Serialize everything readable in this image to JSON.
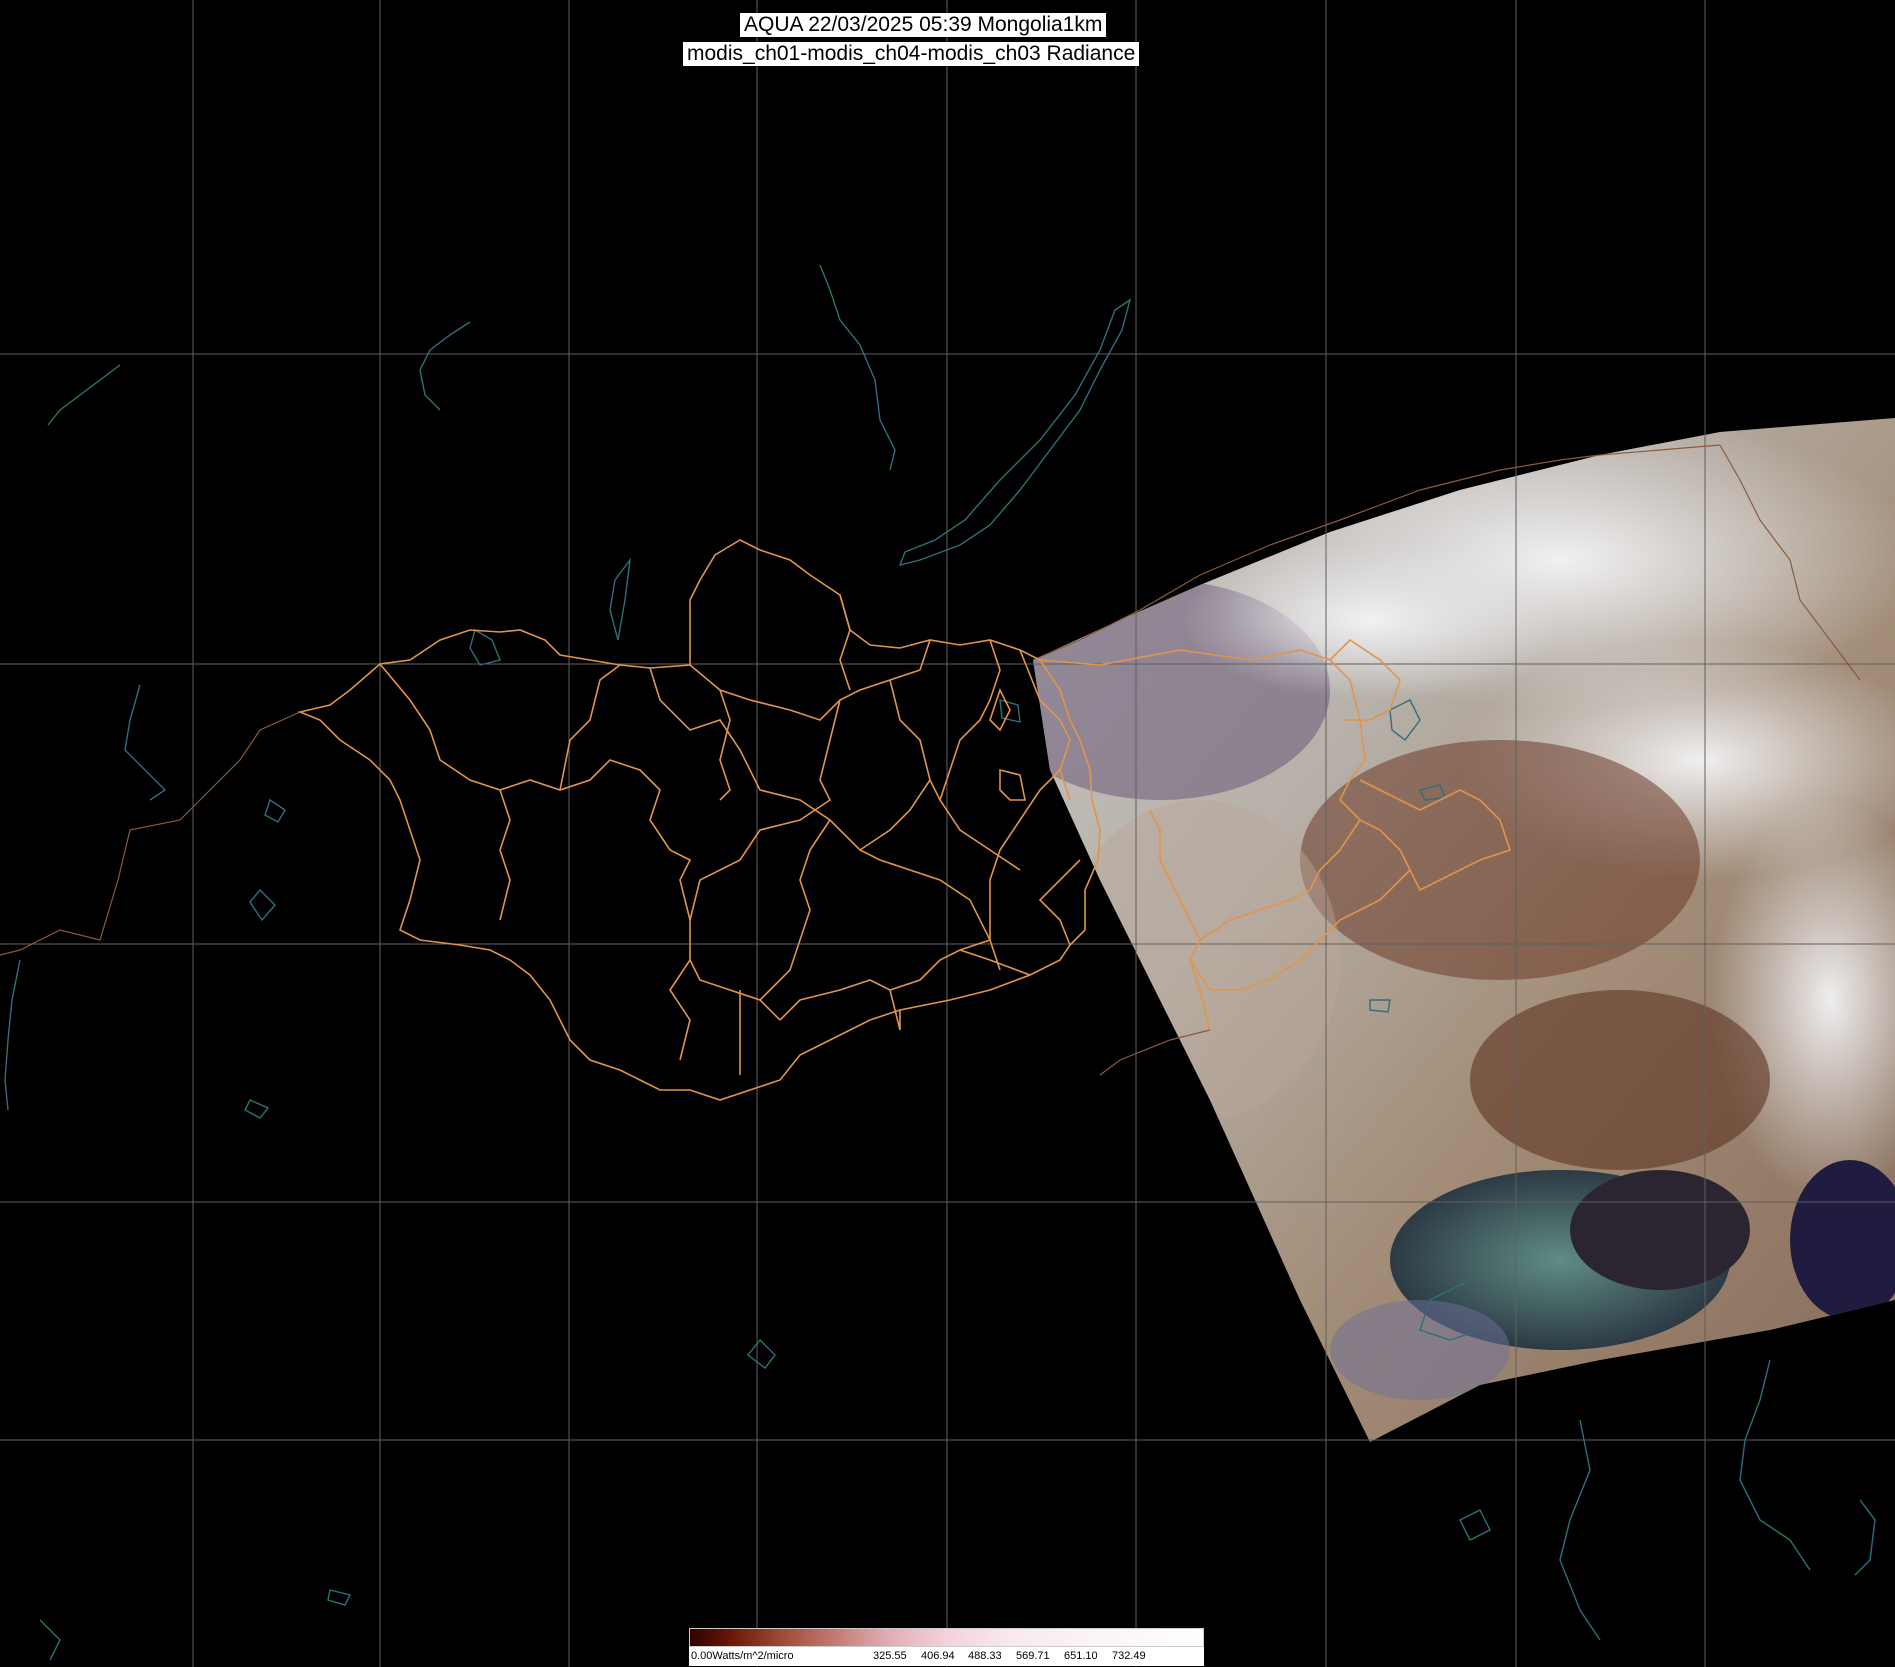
{
  "title": {
    "line1": "AQUA 22/03/2025 05:39 Mongolia1km",
    "line2": "modis_ch01-modis_ch04-modis_ch03 Radiance"
  },
  "colorbar": {
    "unit_label": "0.00Watts/m^2/micro",
    "ticks": [
      "325.55",
      "406.94",
      "488.33",
      "569.71",
      "651.10",
      "732.49"
    ]
  },
  "colors": {
    "background": "#000000",
    "graticule": "#5f5f5f",
    "coastline": "#2e6f7a",
    "province_border": "#e0954a",
    "country_border": "#8a5a3a"
  }
}
